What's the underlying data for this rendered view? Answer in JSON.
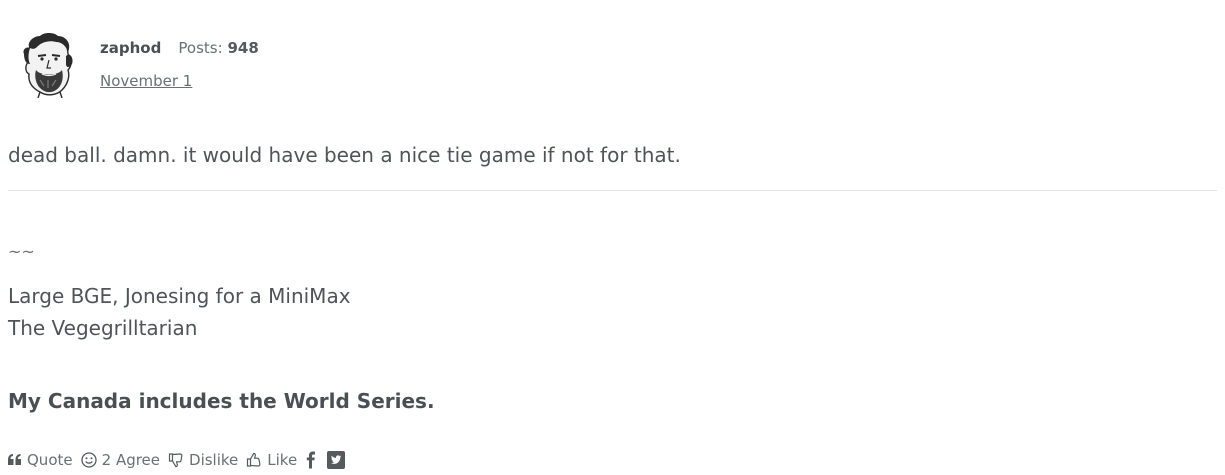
{
  "author": {
    "name": "zaphod",
    "posts_label": "Posts:",
    "posts_count": "948",
    "date": "November 1"
  },
  "post": {
    "body": "dead ball. damn. it would have been a nice tie game if not for that."
  },
  "signature": {
    "tilde": "~~",
    "line1": "Large BGE, Jonesing for a MiniMax",
    "line2": "The Vegegrilltarian",
    "bold_line": "My Canada includes the World Series."
  },
  "reactions": {
    "quote_label": "Quote",
    "agree_count": "2",
    "agree_label": "Agree",
    "dislike_label": "Dislike",
    "like_label": "Like"
  },
  "icons": {
    "quote": "quote-icon",
    "agree": "smiley-icon",
    "dislike": "thumbs-down-icon",
    "like": "thumbs-up-icon",
    "facebook": "facebook-icon",
    "twitter": "twitter-icon"
  },
  "colors": {
    "text": "#4f5459",
    "muted": "#6b7075",
    "divider": "#e2e4e6"
  }
}
